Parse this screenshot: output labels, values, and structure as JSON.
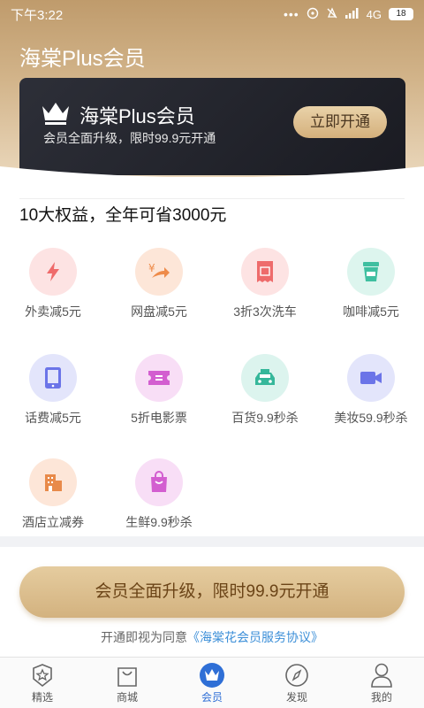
{
  "status_bar": {
    "time": "下午3:22",
    "network": "4G",
    "battery": "18"
  },
  "header": {
    "title": "海棠Plus会员"
  },
  "vip_card": {
    "title": "海棠Plus会员",
    "subtitle": "会员全面升级，限时99.9元开通",
    "button_label": "立即开通"
  },
  "benefits": {
    "title": "10大权益，全年可省3000元",
    "items": [
      {
        "label": "外卖减5元",
        "icon": "lightning-icon",
        "color": "#ef6b6b",
        "bg": "#fde3e3"
      },
      {
        "label": "网盘减5元",
        "icon": "yen-arrow-icon",
        "color": "#ee8b4a",
        "bg": "#fde6d8"
      },
      {
        "label": "3折3次洗车",
        "icon": "ticket-icon",
        "color": "#ee6b6b",
        "bg": "#fde3e3"
      },
      {
        "label": "咖啡减5元",
        "icon": "coffee-cup-icon",
        "color": "#3fbfa0",
        "bg": "#ddf5ee"
      },
      {
        "label": "话费减5元",
        "icon": "tablet-icon",
        "color": "#6b74e8",
        "bg": "#e3e5fb"
      },
      {
        "label": "5折电影票",
        "icon": "film-ticket-icon",
        "color": "#d35ed0",
        "bg": "#f8def6"
      },
      {
        "label": "百货9.9秒杀",
        "icon": "car-icon",
        "color": "#35b79a",
        "bg": "#dcf4ee"
      },
      {
        "label": "美妆59.9秒杀",
        "icon": "video-camera-icon",
        "color": "#6b74e8",
        "bg": "#e3e5fb"
      },
      {
        "label": "酒店立减券",
        "icon": "hotel-building-icon",
        "color": "#e88a4a",
        "bg": "#fde6d8"
      },
      {
        "label": "生鲜9.9秒杀",
        "icon": "shopping-bag-icon",
        "color": "#d35ed0",
        "bg": "#f8def6"
      }
    ]
  },
  "cta": {
    "label": "会员全面升级，限时99.9元开通",
    "agreement_prefix": "开通即视为同意",
    "agreement_link": "《海棠花会员服务协议》"
  },
  "tabbar": {
    "tabs": [
      {
        "label": "精选",
        "icon": "star-badge-icon",
        "active": false
      },
      {
        "label": "商城",
        "icon": "shopping-bag-icon",
        "active": false
      },
      {
        "label": "会员",
        "icon": "crown-icon",
        "active": true
      },
      {
        "label": "发现",
        "icon": "compass-icon",
        "active": false
      },
      {
        "label": "我的",
        "icon": "person-icon",
        "active": false
      }
    ]
  },
  "colors": {
    "gold_dark": "#bf9b6c",
    "gold_light": "#ead7bb",
    "card_dark": "#1a1b22",
    "active_blue": "#2f6fd6",
    "link_blue": "#3c8fd8"
  }
}
